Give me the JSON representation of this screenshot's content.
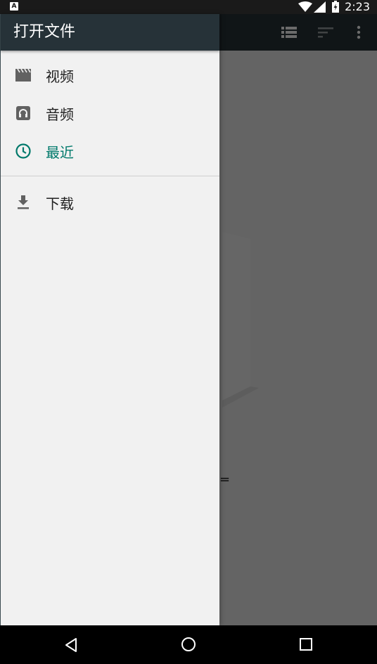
{
  "status_bar": {
    "notification_icon": "A",
    "time": "2:23",
    "icons": [
      "wifi-icon",
      "signal-icon",
      "battery-charging-icon"
    ]
  },
  "drawer": {
    "title": "打开文件",
    "items": [
      {
        "label": "视频",
        "icon": "movie-icon",
        "active": false
      },
      {
        "label": "音频",
        "icon": "headphones-icon",
        "active": false
      },
      {
        "label": "最近",
        "icon": "clock-icon",
        "active": true
      }
    ],
    "secondary_items": [
      {
        "label": "下载",
        "icon": "download-icon",
        "active": false
      }
    ],
    "accent_color": "#00796b",
    "header_color": "#263238"
  },
  "background_app": {
    "toolbar_icons": [
      "list-view-icon",
      "sort-icon",
      "more-vert-icon"
    ],
    "content_fragment": "="
  },
  "nav_bar": {
    "buttons": [
      "back-icon",
      "home-icon",
      "recents-icon"
    ]
  }
}
